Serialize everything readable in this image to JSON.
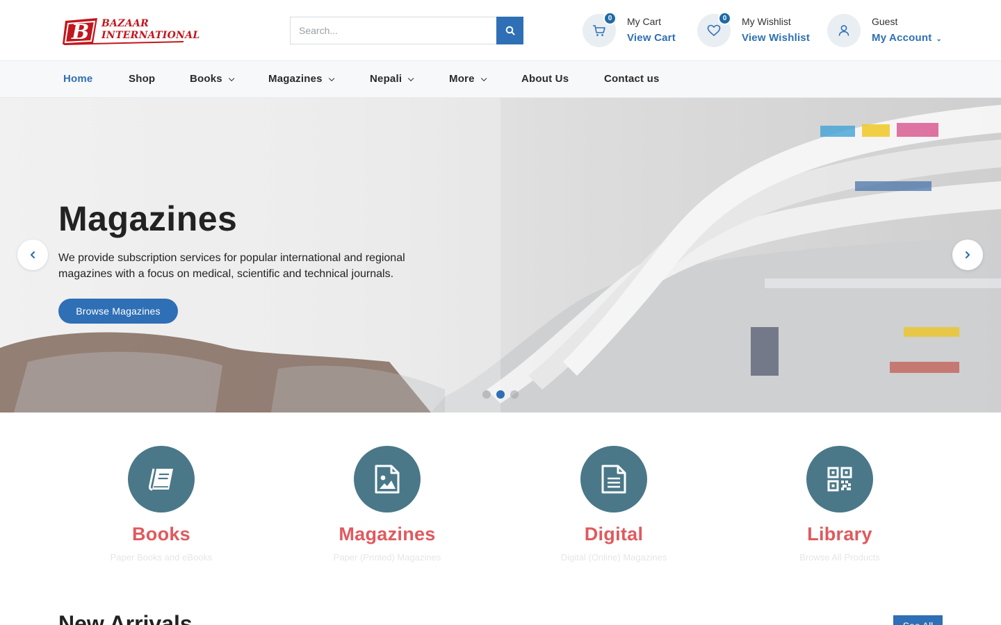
{
  "header": {
    "logo_text_line1": "BAZAAR",
    "logo_text_line2": "INTERNATIONAL",
    "search_placeholder": "Search...",
    "cart": {
      "count": "0",
      "label": "My Cart",
      "link": "View Cart"
    },
    "wishlist": {
      "count": "0",
      "label": "My Wishlist",
      "link": "View Wishlist"
    },
    "account": {
      "label": "Guest",
      "link": "My Account"
    }
  },
  "nav": {
    "items": [
      {
        "label": "Home",
        "active": true
      },
      {
        "label": "Shop"
      },
      {
        "label": "Books",
        "dropdown": true
      },
      {
        "label": "Magazines",
        "dropdown": true
      },
      {
        "label": "Nepali",
        "dropdown": true
      },
      {
        "label": "More",
        "dropdown": true
      },
      {
        "label": "About Us"
      },
      {
        "label": "Contact us"
      }
    ]
  },
  "hero": {
    "title": "Magazines",
    "text": "We provide subscription services for popular international and regional magazines with a focus on medical, scientific and technical journals.",
    "button": "Browse Magazines",
    "active_slide": 2,
    "slide_count": 3
  },
  "categories": [
    {
      "icon": "book-icon",
      "title": "Books",
      "subtitle": "Paper Books and eBooks"
    },
    {
      "icon": "image-file-icon",
      "title": "Magazines",
      "subtitle": "Paper (Printed) Magazines"
    },
    {
      "icon": "document-icon",
      "title": "Digital",
      "subtitle": "Digital (Online) Magazines"
    },
    {
      "icon": "qr-code-icon",
      "title": "Library",
      "subtitle": "Browse All Products"
    }
  ],
  "new_arrivals": {
    "title": "New Arrivals",
    "see_all": "See All"
  },
  "colors": {
    "accent": "#2f6fb5",
    "category_circle": "#4a7888",
    "category_title": "#e0595d",
    "logo_red": "#c2161d"
  }
}
